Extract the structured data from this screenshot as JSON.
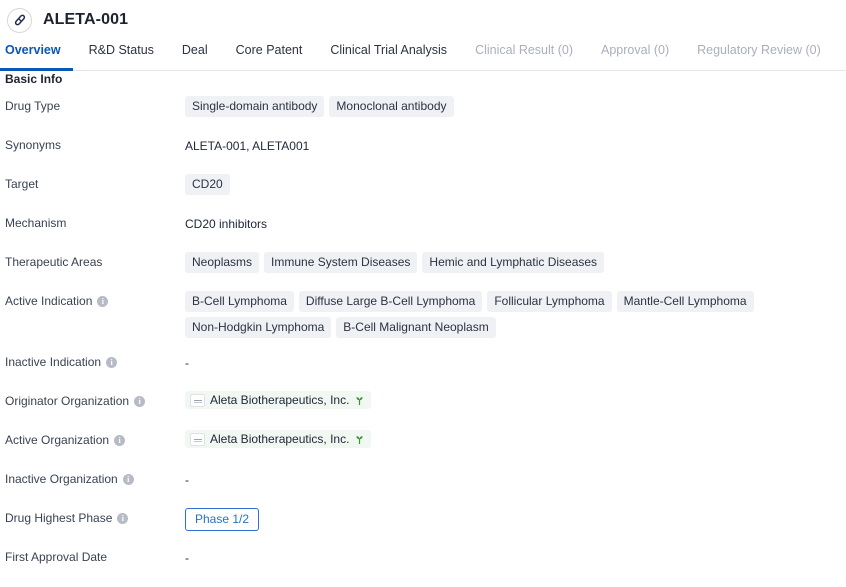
{
  "header": {
    "icon": "pill-capsule-icon",
    "title": "ALETA-001"
  },
  "tabs": [
    {
      "label": "Overview",
      "state": "active"
    },
    {
      "label": "R&D Status",
      "state": "normal"
    },
    {
      "label": "Deal",
      "state": "normal"
    },
    {
      "label": "Core Patent",
      "state": "normal"
    },
    {
      "label": "Clinical Trial Analysis",
      "state": "normal"
    },
    {
      "label": "Clinical Result (0)",
      "state": "disabled"
    },
    {
      "label": "Approval (0)",
      "state": "disabled"
    },
    {
      "label": "Regulatory Review (0)",
      "state": "disabled"
    }
  ],
  "section": {
    "title": "Basic Info"
  },
  "rows": {
    "drug_type": {
      "label": "Drug Type",
      "chips": [
        "Single-domain antibody",
        "Monoclonal antibody"
      ]
    },
    "synonyms": {
      "label": "Synonyms",
      "text": "ALETA-001,  ALETA001"
    },
    "target": {
      "label": "Target",
      "chips": [
        "CD20"
      ]
    },
    "mechanism": {
      "label": "Mechanism",
      "text": "CD20 inhibitors"
    },
    "therapeutic_areas": {
      "label": "Therapeutic Areas",
      "chips": [
        "Neoplasms",
        "Immune System Diseases",
        "Hemic and Lymphatic Diseases"
      ]
    },
    "active_indication": {
      "label": "Active Indication",
      "has_info": true,
      "chips": [
        "B-Cell Lymphoma",
        "Diffuse Large B-Cell Lymphoma",
        "Follicular Lymphoma",
        "Mantle-Cell Lymphoma",
        "Non-Hodgkin Lymphoma",
        "B-Cell Malignant Neoplasm"
      ]
    },
    "inactive_indication": {
      "label": "Inactive Indication",
      "has_info": true,
      "text": "-"
    },
    "originator_organization": {
      "label": "Originator Organization",
      "has_info": true,
      "org": "Aleta Biotherapeutics, Inc."
    },
    "active_organization": {
      "label": "Active Organization",
      "has_info": true,
      "org": "Aleta Biotherapeutics, Inc."
    },
    "inactive_organization": {
      "label": "Inactive Organization",
      "has_info": true,
      "text": "-"
    },
    "drug_highest_phase": {
      "label": "Drug Highest Phase",
      "has_info": true,
      "phase": "Phase 1/2"
    },
    "first_approval_date": {
      "label": "First Approval Date",
      "text": "-"
    }
  },
  "colors": {
    "accent_blue": "#0a57b5",
    "chip_bg": "#f0f1f4",
    "org_chip_bg": "#f1f8f1",
    "sprout_green": "#3f8f3f",
    "disabled_tab": "#a9afbb",
    "label_text": "#394253"
  },
  "icons": {
    "info": "i",
    "pill": "pill-capsule-icon",
    "sprout": "sprout-icon"
  }
}
